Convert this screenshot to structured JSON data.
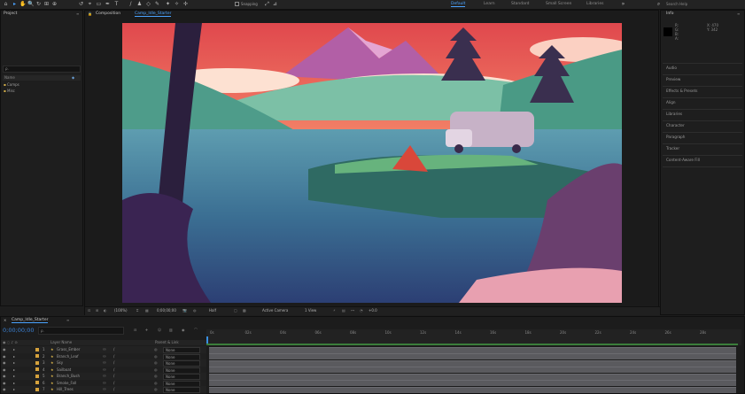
{
  "toolbar": {
    "snapping_label": "Snapping",
    "workspaces": [
      "Default",
      "Learn",
      "Standard",
      "Small Screen",
      "Libraries"
    ],
    "search_placeholder": "Search Help"
  },
  "project_panel": {
    "title": "Project",
    "search_placeholder": "ρ.",
    "column_name": "Name",
    "items": [
      "Comps",
      "Misc"
    ]
  },
  "composition_panel": {
    "title": "Composition",
    "comp_name": "Camp_Idle_Starter",
    "viewer_bar": {
      "zoom": "(100%)",
      "timecode": "0;00;00;00",
      "resolution": "Half",
      "camera": "Active Camera",
      "views": "1 View",
      "exposure": "+0.0"
    }
  },
  "info_panel": {
    "title": "Info",
    "r": "R:",
    "g": "G:",
    "b": "B:",
    "a": "A:",
    "x": "X: 470",
    "y": "Y: 342"
  },
  "right_panels": [
    "Audio",
    "Preview",
    "Effects & Presets",
    "Align",
    "Libraries",
    "Character",
    "Paragraph",
    "Tracker",
    "Content-Aware Fill"
  ],
  "timeline": {
    "tab_label": "Camp_Idle_Starter",
    "timecode": "0;00;00;00",
    "search_placeholder": "ρ.",
    "col_layer_name": "Layer Name",
    "col_parent": "Parent & Link",
    "layers": [
      {
        "num": "1",
        "name": "Grass_Ember",
        "parent": "None",
        "color": "#d6a23c"
      },
      {
        "num": "2",
        "name": "Branch_Leaf",
        "parent": "None",
        "color": "#d6a23c"
      },
      {
        "num": "3",
        "name": "Sky",
        "parent": "None",
        "color": "#d6a23c"
      },
      {
        "num": "4",
        "name": "Sailboat",
        "parent": "None",
        "color": "#d6a23c"
      },
      {
        "num": "5",
        "name": "Branch_Bush",
        "parent": "None",
        "color": "#d6a23c"
      },
      {
        "num": "6",
        "name": "Smoke_Fall",
        "parent": "None",
        "color": "#d6a23c"
      },
      {
        "num": "7",
        "name": "Hill_Trees",
        "parent": "None",
        "color": "#d6a23c"
      }
    ],
    "ruler_ticks": [
      "0s",
      "02s",
      "04s",
      "06s",
      "08s",
      "10s",
      "12s",
      "14s",
      "16s",
      "18s",
      "20s",
      "22s",
      "24s",
      "26s",
      "28s"
    ]
  },
  "colors": {
    "accent": "#4aa3ff",
    "timecode": "#3b82d6",
    "playhead": "#3a8fe0"
  }
}
